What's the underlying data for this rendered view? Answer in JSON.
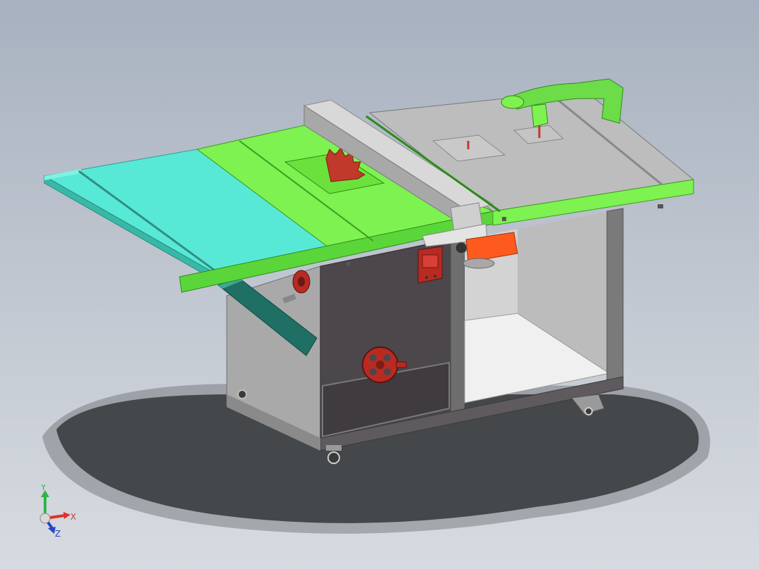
{
  "triad": {
    "x_label": "X",
    "y_label": "Y",
    "z_label": "Z",
    "colors": {
      "x": "#e0312a",
      "y": "#2fb44a",
      "z": "#2446c8"
    }
  },
  "model": {
    "colors": {
      "extension_table": "#58e9d6",
      "main_table": "#7ef250",
      "router_table": "#bdbdbd",
      "cabinet": "#9a9a9a",
      "cabinet_dark": "#4b474b",
      "blade": "#c0392b",
      "handwheel": "#b92a22",
      "motor": "#ff5a1e",
      "fence": "#c9c9c9"
    }
  }
}
